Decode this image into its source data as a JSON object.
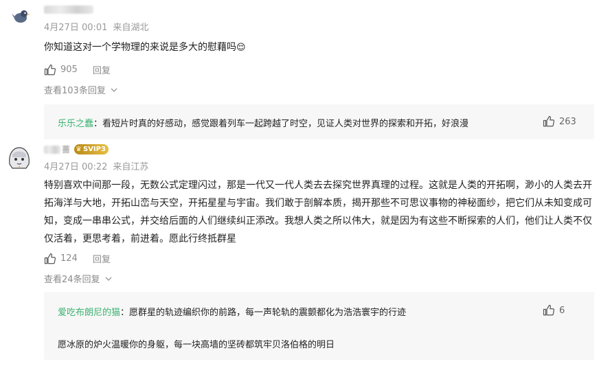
{
  "comments": [
    {
      "time": "4月27日 00:01",
      "location": "来自湖北",
      "content": "你知道这对一个学物理的来说是多大的慰藉吗",
      "emoji": "😌",
      "likes": "905",
      "reply_label": "回复",
      "view_replies": "查看103条回复",
      "reply": {
        "author": "乐乐之蠢",
        "text": "看短片时真的好感动，感觉跟着列车一起跨越了时空，见证人类对世界的探索和开拓，好浪漫",
        "likes": "263"
      }
    },
    {
      "name_suffix": "蔷",
      "badge": "SVIP3",
      "time": "4月27日 00:22",
      "location": "来自江苏",
      "content": "特别喜欢中间那一段，无数公式定理闪过，那是一代又一代人类去去探究世界真理的过程。这就是人类的开拓啊，渺小的人类去开拓海洋与大地，开拓山峦与天空，开拓星星与宇宙。我们敢于剖解本质，揭开那些不可思议事物的神秘面纱，把它们从未知变成可知，变成一串串公式，并交给后面的人们继续纠正添改。我想人类之所以伟大，就是因为有这些不断探索的人们，他们让人类不仅仅活着，更思考着，前进着。愿此行终抵群星",
      "likes": "124",
      "reply_label": "回复",
      "view_replies": "查看24条回复",
      "reply": {
        "author": "爱吃布朗尼的猫",
        "text": "愿群星的轨迹编织你的前路，每一声轮轨的震颤都化为浩浩寰宇的行迹",
        "text2": "愿冰原的炉火温暖你的身躯，每一块高墙的坚砖都筑牢贝洛伯格的明日",
        "likes": "6"
      }
    }
  ],
  "colors": {
    "reply_author": "#3cb371",
    "muted": "#8a8a8a",
    "svip_gold": "#d4a22a"
  }
}
